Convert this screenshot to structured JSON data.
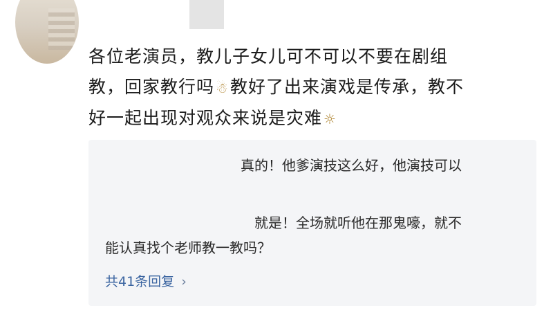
{
  "comment": {
    "line1": "各位老演员，教儿子女儿可不可以不要在剧组",
    "line2a": "教，回家教行吗",
    "line2b": "教好了出来演戏是传承，教不",
    "line3": "好一起出现对观众来说是灾难",
    "emoji1": "person-emoji-icon",
    "emoji2": "lightbulb-emoji-icon"
  },
  "replies": {
    "reply1": "真的！他爹演技这么好，他演技可以",
    "reply2a": "就是！全场就听他在那鬼嚎，就不",
    "reply2b": "能认真找个老师教一教吗？",
    "more_label": "共41条回复",
    "more_chevron": "›"
  },
  "colors": {
    "reply_bg": "#f4f5f7",
    "link": "#3a64a0"
  }
}
